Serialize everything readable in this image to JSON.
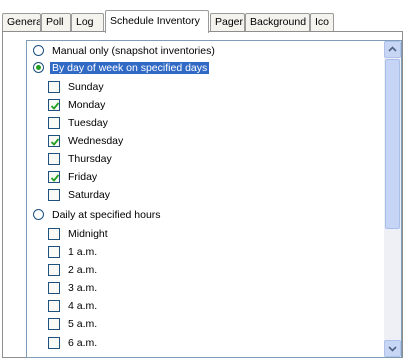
{
  "tabs": [
    {
      "label": "General",
      "active": false
    },
    {
      "label": "Poll",
      "active": false
    },
    {
      "label": "Log",
      "active": false
    },
    {
      "label": "Schedule Inventory",
      "active": true
    },
    {
      "label": "Pager",
      "active": false
    },
    {
      "label": "Background",
      "active": false
    },
    {
      "label": "Ico",
      "active": false
    }
  ],
  "options": {
    "manual": {
      "label": "Manual only (snapshot inventories)",
      "selected": false
    },
    "by_day": {
      "label": "By day of week on specified days",
      "selected": true
    },
    "days": [
      {
        "label": "Sunday",
        "checked": false
      },
      {
        "label": "Monday",
        "checked": true
      },
      {
        "label": "Tuesday",
        "checked": false
      },
      {
        "label": "Wednesday",
        "checked": true
      },
      {
        "label": "Thursday",
        "checked": false
      },
      {
        "label": "Friday",
        "checked": true
      },
      {
        "label": "Saturday",
        "checked": false
      }
    ],
    "daily": {
      "label": "Daily at specified hours",
      "selected": false
    },
    "hours": [
      {
        "label": "Midnight",
        "checked": false
      },
      {
        "label": "1 a.m.",
        "checked": false
      },
      {
        "label": "2 a.m.",
        "checked": false
      },
      {
        "label": "3 a.m.",
        "checked": false
      },
      {
        "label": "4 a.m.",
        "checked": false
      },
      {
        "label": "5 a.m.",
        "checked": false
      },
      {
        "label": "6 a.m.",
        "checked": false
      }
    ]
  },
  "icons": {
    "scroll_up": "chevron-up-icon",
    "scroll_down": "chevron-down-icon",
    "check": "checkmark-icon"
  },
  "colors": {
    "selection": "#316ac5",
    "radio_dot": "#21a121",
    "checkmark": "#21a121"
  }
}
